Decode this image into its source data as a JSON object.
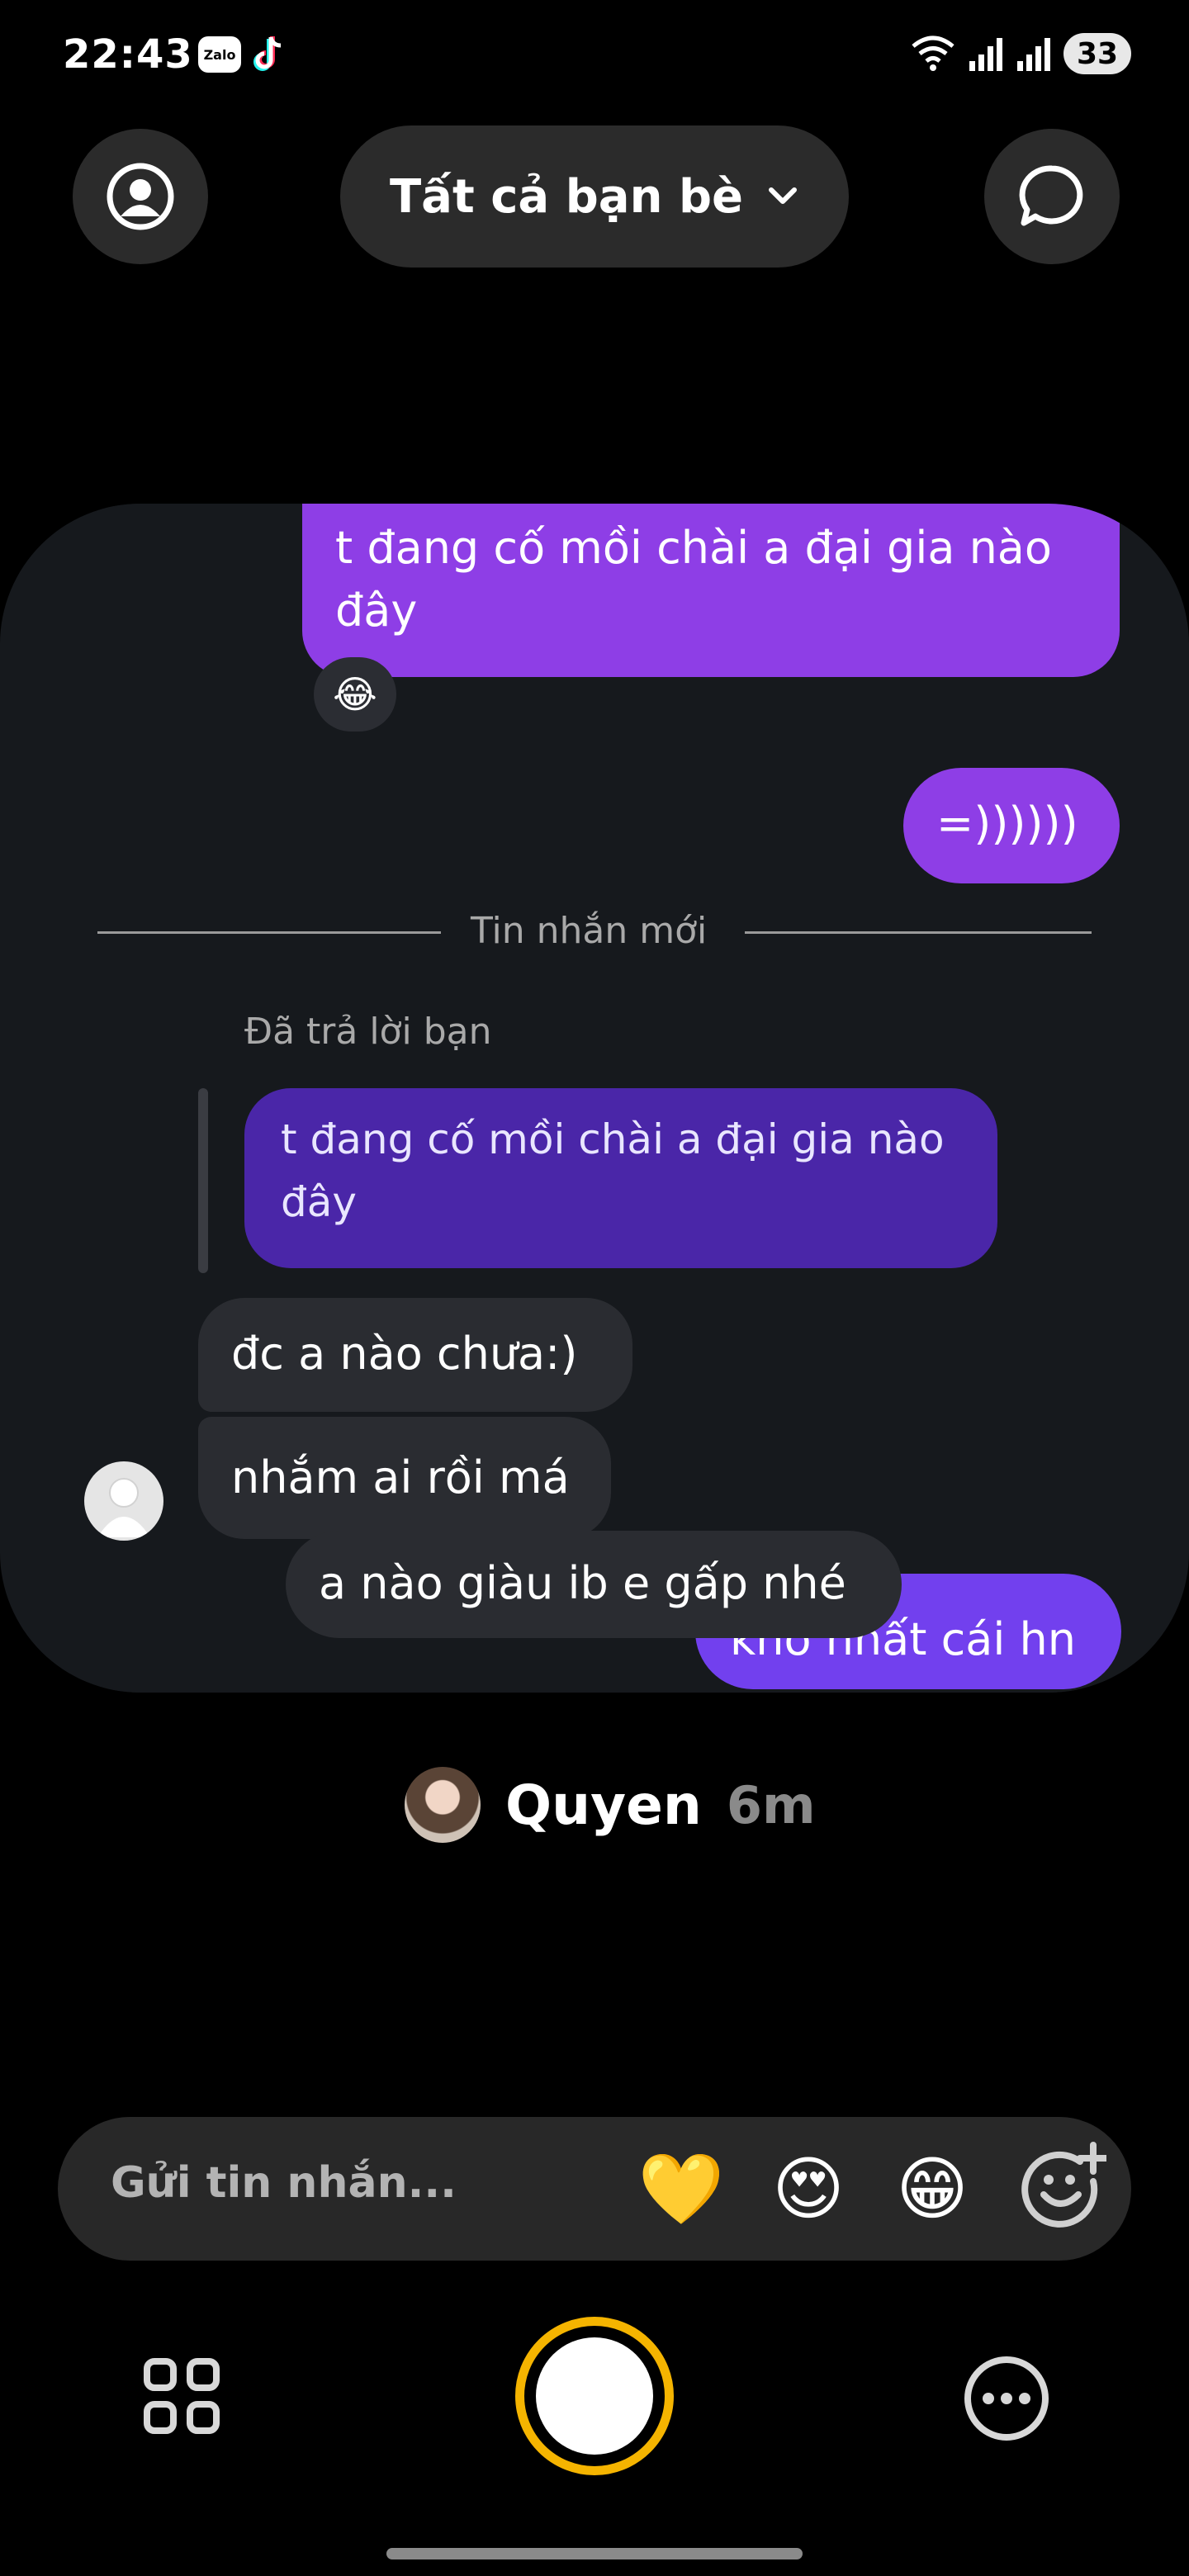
{
  "status_bar": {
    "time": "22:43",
    "app_icons": [
      "zalo-icon",
      "tiktok-icon"
    ],
    "zalo_text": "Zalo",
    "battery": "33"
  },
  "top_bar": {
    "friends_filter": "Tất cả bạn bè",
    "left_icon": "profile-icon",
    "right_icon": "chat-bubble-icon"
  },
  "conversation": {
    "messages": [
      {
        "from": "me",
        "text": "t đang cố mồi chài a đại gia nào đây",
        "reaction": "😂"
      },
      {
        "from": "me",
        "text": "=))))))"
      }
    ],
    "divider_label": "Tin nhắn mới",
    "reply_label": "Đã trả lời bạn",
    "quoted_text": "t đang cố mồi chài a đại gia nào đây",
    "replies": [
      {
        "from": "them",
        "text": "đc a nào chưa:)"
      },
      {
        "from": "them",
        "text": "nhắm ai rồi má"
      },
      {
        "from": "them",
        "text": "a nào giàu ib e gấp nhé"
      },
      {
        "from": "me",
        "text": "khổ nhất cái hn"
      }
    ]
  },
  "author": {
    "name": "Quyen",
    "time": "6m"
  },
  "message_bar": {
    "placeholder": "Gửi tin nhắn...",
    "quick_reactions": [
      "💛",
      "😍",
      "😁"
    ],
    "add_reaction_icon": "add-emoji-icon"
  },
  "bottom_bar": {
    "left_icon": "grid-icon",
    "right_icon": "more-icon"
  },
  "colors": {
    "accent": "#f5b400",
    "my_bubble": "#8e3ee6",
    "quoted_bubble": "#4a26a8",
    "their_bubble": "#2a2c31"
  }
}
